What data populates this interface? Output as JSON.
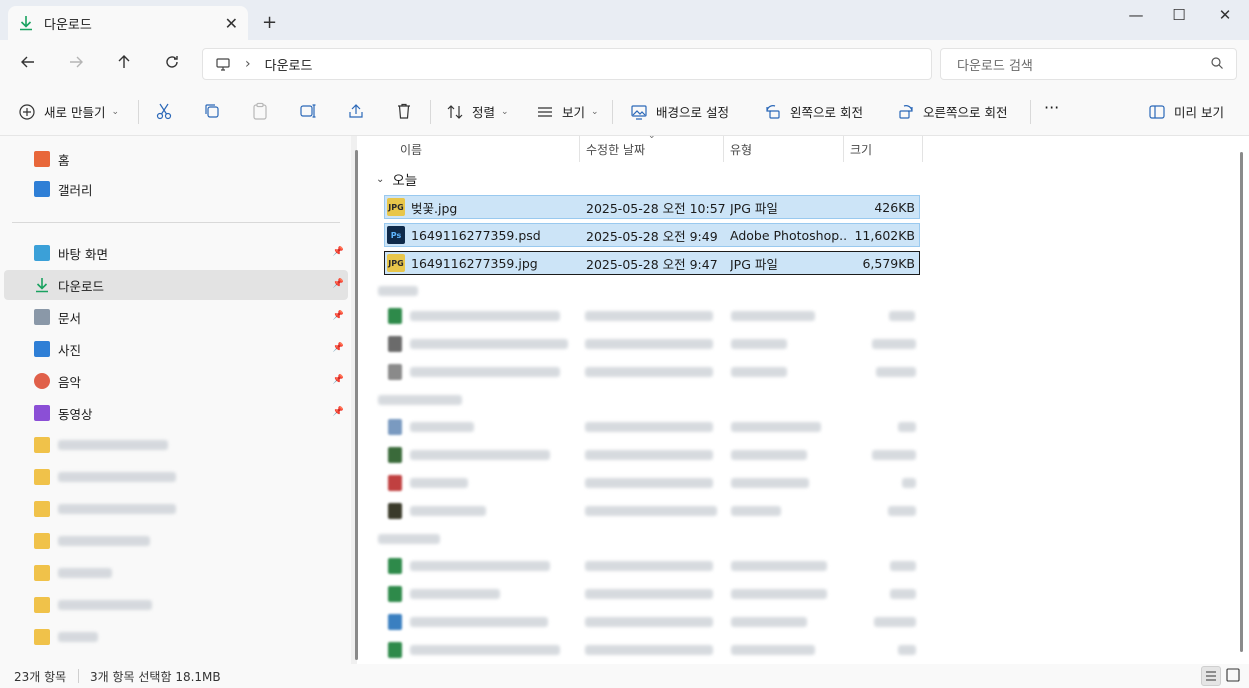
{
  "window": {
    "tab_title": "다운로드",
    "tab_close": "✕",
    "new_tab": "+",
    "minimize": "—",
    "maximize": "☐",
    "close": "✕"
  },
  "address": {
    "separator": "›",
    "breadcrumb": "다운로드",
    "search_placeholder": "다운로드 검색"
  },
  "toolbar": {
    "new_label": "새로 만들기",
    "sort_label": "정렬",
    "view_label": "보기",
    "set_background_label": "배경으로 설정",
    "rotate_left_label": "왼쪽으로 회전",
    "rotate_right_label": "오른쪽으로 회전",
    "more_label": "···",
    "preview_label": "미리 보기",
    "dropdown_chevron": "⌄"
  },
  "sidebar": {
    "top_items": [
      {
        "label": "홈",
        "icon": "home-icon",
        "color": "#e8673a"
      },
      {
        "label": "갤러리",
        "icon": "gallery-icon",
        "color": "#2f7fd6"
      }
    ],
    "pinned_items": [
      {
        "label": "바탕 화면",
        "icon": "desktop-icon",
        "color": "#3ba0d8"
      },
      {
        "label": "다운로드",
        "icon": "download-icon",
        "color": "#1aa260"
      },
      {
        "label": "문서",
        "icon": "documents-icon",
        "color": "#8a98a8"
      },
      {
        "label": "사진",
        "icon": "pictures-icon",
        "color": "#2f7fd6"
      },
      {
        "label": "음악",
        "icon": "music-icon",
        "color": "#e0604a"
      },
      {
        "label": "동영상",
        "icon": "videos-icon",
        "color": "#8b4fd6"
      }
    ],
    "pin_glyph": "📌"
  },
  "columns": {
    "name": "이름",
    "date": "수정한 날짜",
    "type": "유형",
    "size": "크기",
    "sort_indicator": "⌄"
  },
  "groups": {
    "today": "오늘",
    "chevron": "⌄"
  },
  "files": [
    {
      "name": "벚꽃.jpg",
      "date": "2025-05-28 오전 10:57",
      "type": "JPG 파일",
      "size": "426KB",
      "icon": "jpg-file-icon",
      "icon_text": "JPG",
      "icon_color": "#e8c64a"
    },
    {
      "name": "1649116277359.psd",
      "date": "2025-05-28 오전 9:49",
      "type": "Adobe Photoshop...",
      "size": "11,602KB",
      "icon": "psd-file-icon",
      "icon_text": "Ps",
      "icon_color": "#0f2a4a"
    },
    {
      "name": "1649116277359.jpg",
      "date": "2025-05-28 오전 9:47",
      "type": "JPG 파일",
      "size": "6,579KB",
      "icon": "jpg-file-icon",
      "icon_text": "JPG",
      "icon_color": "#e8c64a"
    }
  ],
  "status": {
    "item_count": "23개 항목",
    "selection": "3개 항목 선택함 18.1MB"
  },
  "colors": {
    "accent": "#0067c0",
    "selection_bg": "#cce4f7",
    "selection_border": "#99c9ef",
    "download_green": "#1aa260"
  }
}
